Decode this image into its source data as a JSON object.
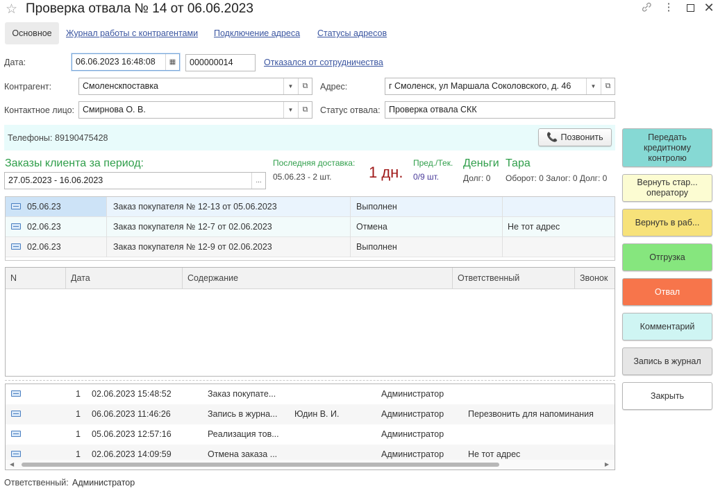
{
  "window": {
    "title": "Проверка отвала № 14 от 06.06.2023",
    "link_icon": "link-icon",
    "menu_icon": "more-vertical-icon",
    "maximize_icon": "maximize-icon",
    "close_icon": "close-icon"
  },
  "tabs": [
    {
      "label": "Основное"
    },
    {
      "label": "Журнал работы с контрагентами"
    },
    {
      "label": "Подключение адреса"
    },
    {
      "label": "Статусы адресов"
    }
  ],
  "form": {
    "date_label": "Дата:",
    "date_value": "06.06.2023 16:48:08",
    "number_value": "000000014",
    "refused_link": "Отказался от сотрудничества",
    "contractor_label": "Контрагент:",
    "contractor_value": "Смоленскпоставка",
    "address_label": "Адрес:",
    "address_value": "г Смоленск,  ул Маршала Соколовского,  д. 46",
    "contact_label": "Контактное лицо:",
    "contact_value": "Смирнова О. В.",
    "status_label": "Статус отвала:",
    "status_value": "Проверка отвала СКК"
  },
  "phone": {
    "label": "Телефоны:",
    "value": "89190475428",
    "call_button": "Позвонить"
  },
  "orders": {
    "title": "Заказы клиента за период:",
    "period": "27.05.2023 - 16.06.2023",
    "period_button": "...",
    "last_delivery_label": "Последняя доставка:",
    "last_delivery_value": "05.06.23 - 2 шт.",
    "days": "1 дн.",
    "prev_cur_label": "Пред./Тек.",
    "prev_cur_value": "0/9 шт.",
    "money_label": "Деньги",
    "debt": "Долг: 0",
    "tara_label": "Тара",
    "tara_value": "Оборот: 0 Залог: 0 Долг: 0"
  },
  "order_rows": [
    {
      "date": "05.06.23",
      "doc": "Заказ покупателя № 12-13 от 05.06.2023",
      "status": "Выполнен",
      "note": ""
    },
    {
      "date": "02.06.23",
      "doc": "Заказ покупателя № 12-7 от 02.06.2023",
      "status": "Отмена",
      "note": "Не тот адрес"
    },
    {
      "date": "02.06.23",
      "doc": "Заказ покупателя № 12-9 от 02.06.2023",
      "status": "Выполнен",
      "note": ""
    }
  ],
  "calls_table": {
    "headers": [
      "N",
      "Дата",
      "Содержание",
      "Ответственный",
      "Звонок"
    ]
  },
  "journal_rows": [
    {
      "n": "1",
      "date": "02.06.2023 15:48:52",
      "content": "Заказ покупате...",
      "person": "",
      "resp": "Администратор",
      "comment": ""
    },
    {
      "n": "1",
      "date": "06.06.2023 11:46:26",
      "content": "Запись в журна...",
      "person": "Юдин В. И.",
      "resp": "Администратор",
      "comment": "Перезвонить для напоминания"
    },
    {
      "n": "1",
      "date": "05.06.2023 12:57:16",
      "content": "Реализация тов...",
      "person": "",
      "resp": "Администратор",
      "comment": ""
    },
    {
      "n": "1",
      "date": "02.06.2023 14:09:59",
      "content": "Отмена заказа ...",
      "person": "",
      "resp": "Администратор",
      "comment": "Не тот адрес"
    }
  ],
  "side_buttons": [
    {
      "label": "Передать кредитному контролю",
      "color": "#86d9d4"
    },
    {
      "label": "Вернуть стар... оператору",
      "color": "#fcfcd2"
    },
    {
      "label": "Вернуть в раб...",
      "color": "#f7e27a"
    },
    {
      "label": "Отгрузка",
      "color": "#86e67e"
    },
    {
      "label": "Отвал",
      "color": "#f7754b"
    },
    {
      "label": "Комментарий",
      "color": "#cff5f3"
    },
    {
      "label": "Запись в журнал",
      "color": "#e6e6e6"
    },
    {
      "label": "Закрыть",
      "color": "#ffffff"
    }
  ],
  "footer": {
    "label": "Ответственный:",
    "value": "Администратор"
  }
}
